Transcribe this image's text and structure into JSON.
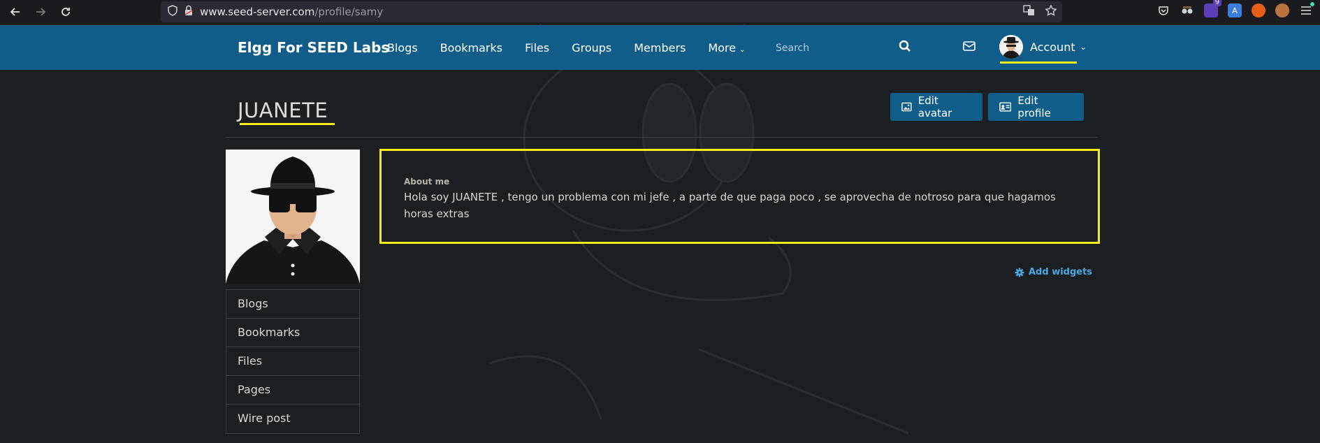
{
  "browser": {
    "url_host": "www.seed-server.com",
    "url_path": "/profile/samy",
    "extension_badge": "9"
  },
  "site": {
    "title": "Elgg For SEED Labs",
    "nav": [
      "Blogs",
      "Bookmarks",
      "Files",
      "Groups",
      "Members",
      "More"
    ],
    "search_placeholder": "Search",
    "account_label": "Account"
  },
  "profile": {
    "display_name": "JUANETE",
    "edit_avatar_label": "Edit avatar",
    "edit_profile_label": "Edit profile",
    "about_label": "About me",
    "about_text": "Hola soy JUANETE , tengo un problema con mi jefe , a parte de que paga poco , se aprovecha de notroso para que hagamos horas extras",
    "owner_menu": [
      "Blogs",
      "Bookmarks",
      "Files",
      "Pages",
      "Wire post"
    ],
    "add_widgets_label": "Add widgets"
  },
  "colors": {
    "topbar": "#0f5d88",
    "highlight": "#f7ea15",
    "link": "#4aa7e0"
  }
}
